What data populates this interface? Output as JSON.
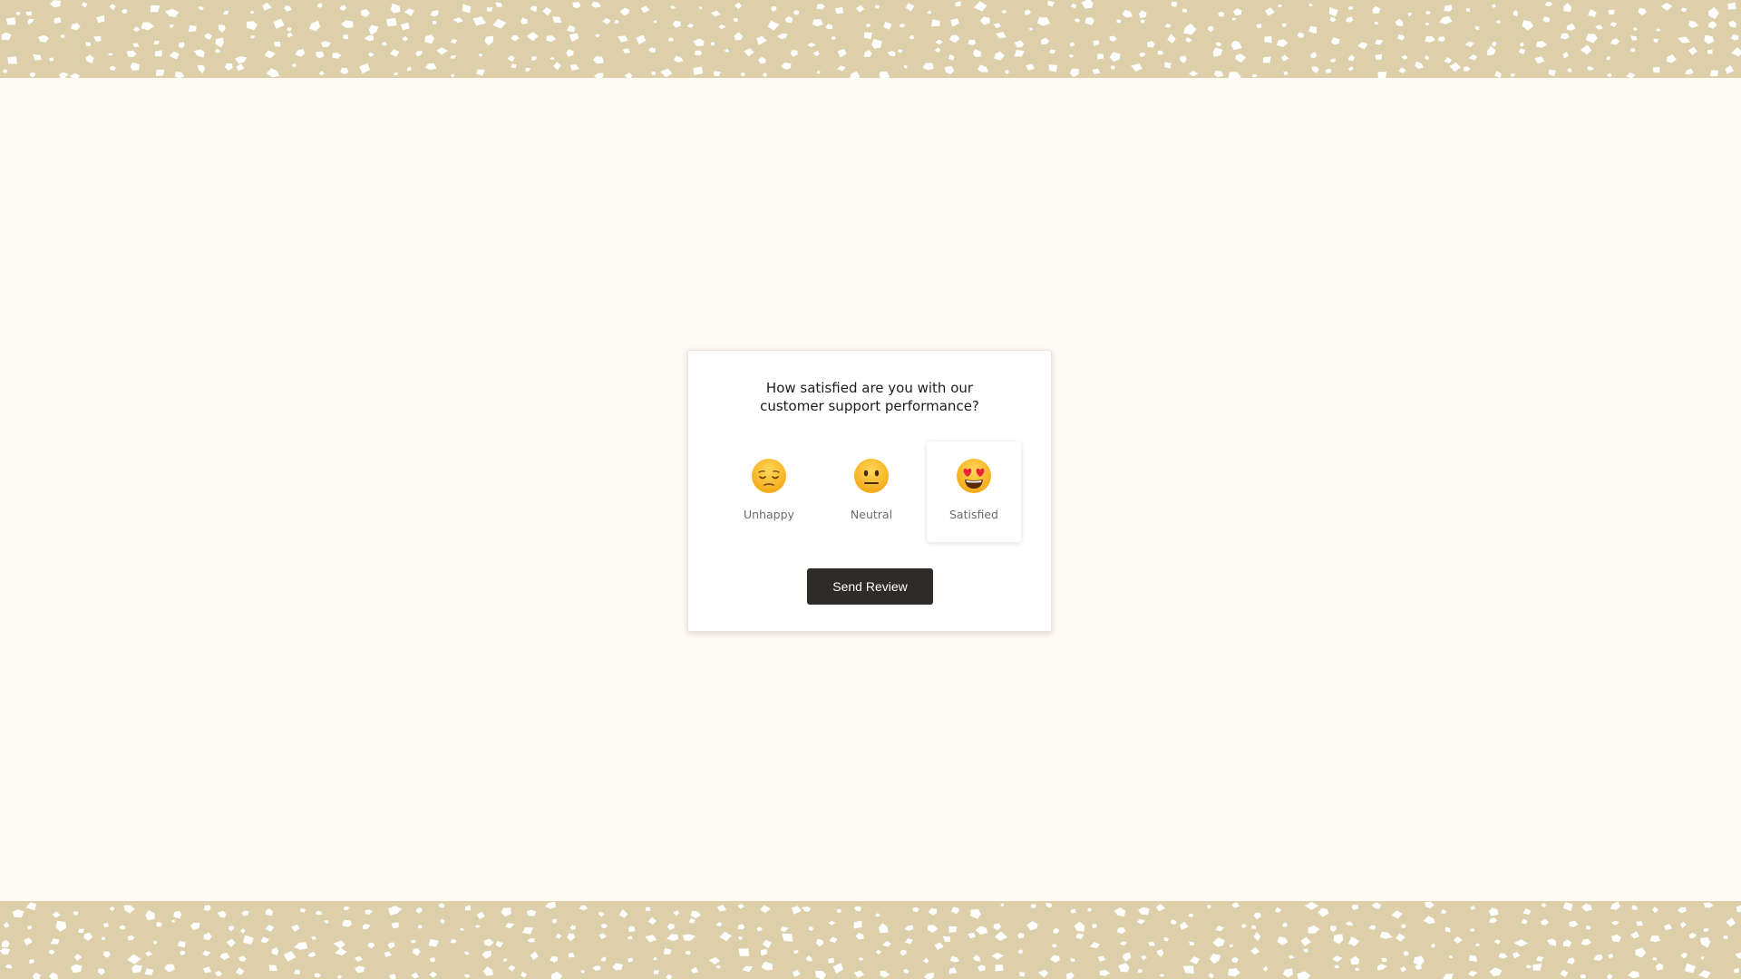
{
  "page": {
    "background_color": "#fdf9f3",
    "pattern_color": "#dccfaa"
  },
  "survey": {
    "question_line1": "How satisfied are you with our",
    "question_line2": "customer support performance?",
    "options": [
      {
        "label": "Unhappy",
        "icon": "relieved-face-icon",
        "selected": false
      },
      {
        "label": "Neutral",
        "icon": "neutral-face-icon",
        "selected": false
      },
      {
        "label": "Satisfied",
        "icon": "heart-eyes-face-icon",
        "selected": true
      }
    ],
    "send_button_label": "Send Review",
    "button_color": "#2f2b28"
  }
}
